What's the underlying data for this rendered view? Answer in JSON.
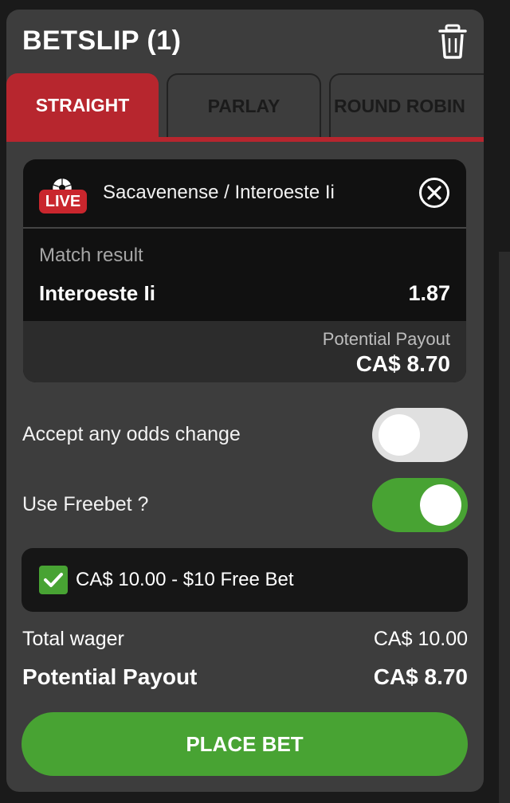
{
  "betslip": {
    "title": "BETSLIP (1)",
    "tabs": [
      {
        "label": "STRAIGHT",
        "active": true
      },
      {
        "label": "PARLAY",
        "active": false
      },
      {
        "label": "ROUND ROBIN",
        "active": false
      }
    ]
  },
  "bet": {
    "live_label": "LIVE",
    "event": "Sacavenense / Interoeste Ii",
    "market": "Match result",
    "selection": "Interoeste Ii",
    "odds": "1.87",
    "payout_label": "Potential Payout",
    "payout_value": "CA$ 8.70"
  },
  "options": {
    "accept_odds_label": "Accept any odds change",
    "accept_odds_on": false,
    "freebet_label": "Use Freebet ?",
    "freebet_on": true,
    "freebet_item": "CA$ 10.00 - $10 Free Bet",
    "freebet_checked": true
  },
  "summary": {
    "total_wager_label": "Total wager",
    "total_wager_value": "CA$ 10.00",
    "potential_payout_label": "Potential Payout",
    "potential_payout_value": "CA$ 8.70"
  },
  "actions": {
    "place_bet_label": "PLACE BET"
  },
  "colors": {
    "accent_red": "#b7262e",
    "accent_green": "#48a333",
    "panel_bg": "#3d3d3d"
  },
  "icons": {
    "clear": "trash-icon",
    "remove": "close-circle-icon",
    "live": "soccer-ball-icon",
    "checkbox": "checkmark-icon"
  }
}
